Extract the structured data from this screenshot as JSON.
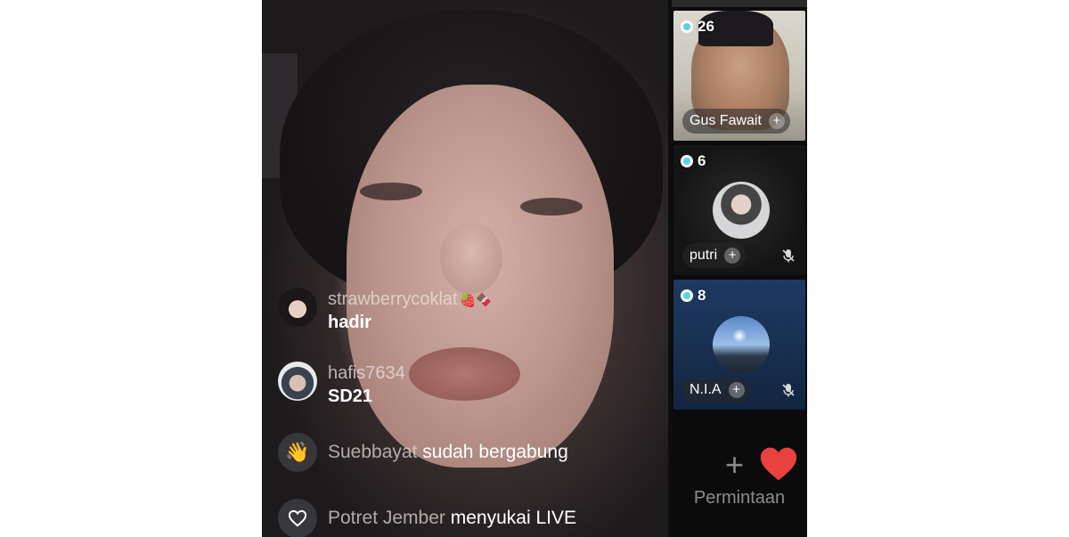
{
  "chat": {
    "messages": [
      {
        "username": "strawberrycoklat",
        "emoji": "🍓🍫",
        "text": "hadir"
      },
      {
        "username": "hafis7634",
        "text": "SD21"
      }
    ],
    "events": [
      {
        "icon": "wave-icon",
        "name": "Suebbayat",
        "action": "sudah bergabung"
      },
      {
        "icon": "heart-outline-icon",
        "name": "Potret Jember",
        "action": "menyukai LIVE"
      }
    ]
  },
  "guests": [
    {
      "viewers": "26",
      "name": "Gus Fawait",
      "muted": false
    },
    {
      "viewers": "6",
      "name": "putri",
      "muted": true
    },
    {
      "viewers": "8",
      "name": "N.I.A",
      "muted": true
    }
  ],
  "request": {
    "label": "Permintaan",
    "plus": "+"
  },
  "colors": {
    "viewer_dot": "#4fd6e2",
    "heart": "#e8413f"
  }
}
